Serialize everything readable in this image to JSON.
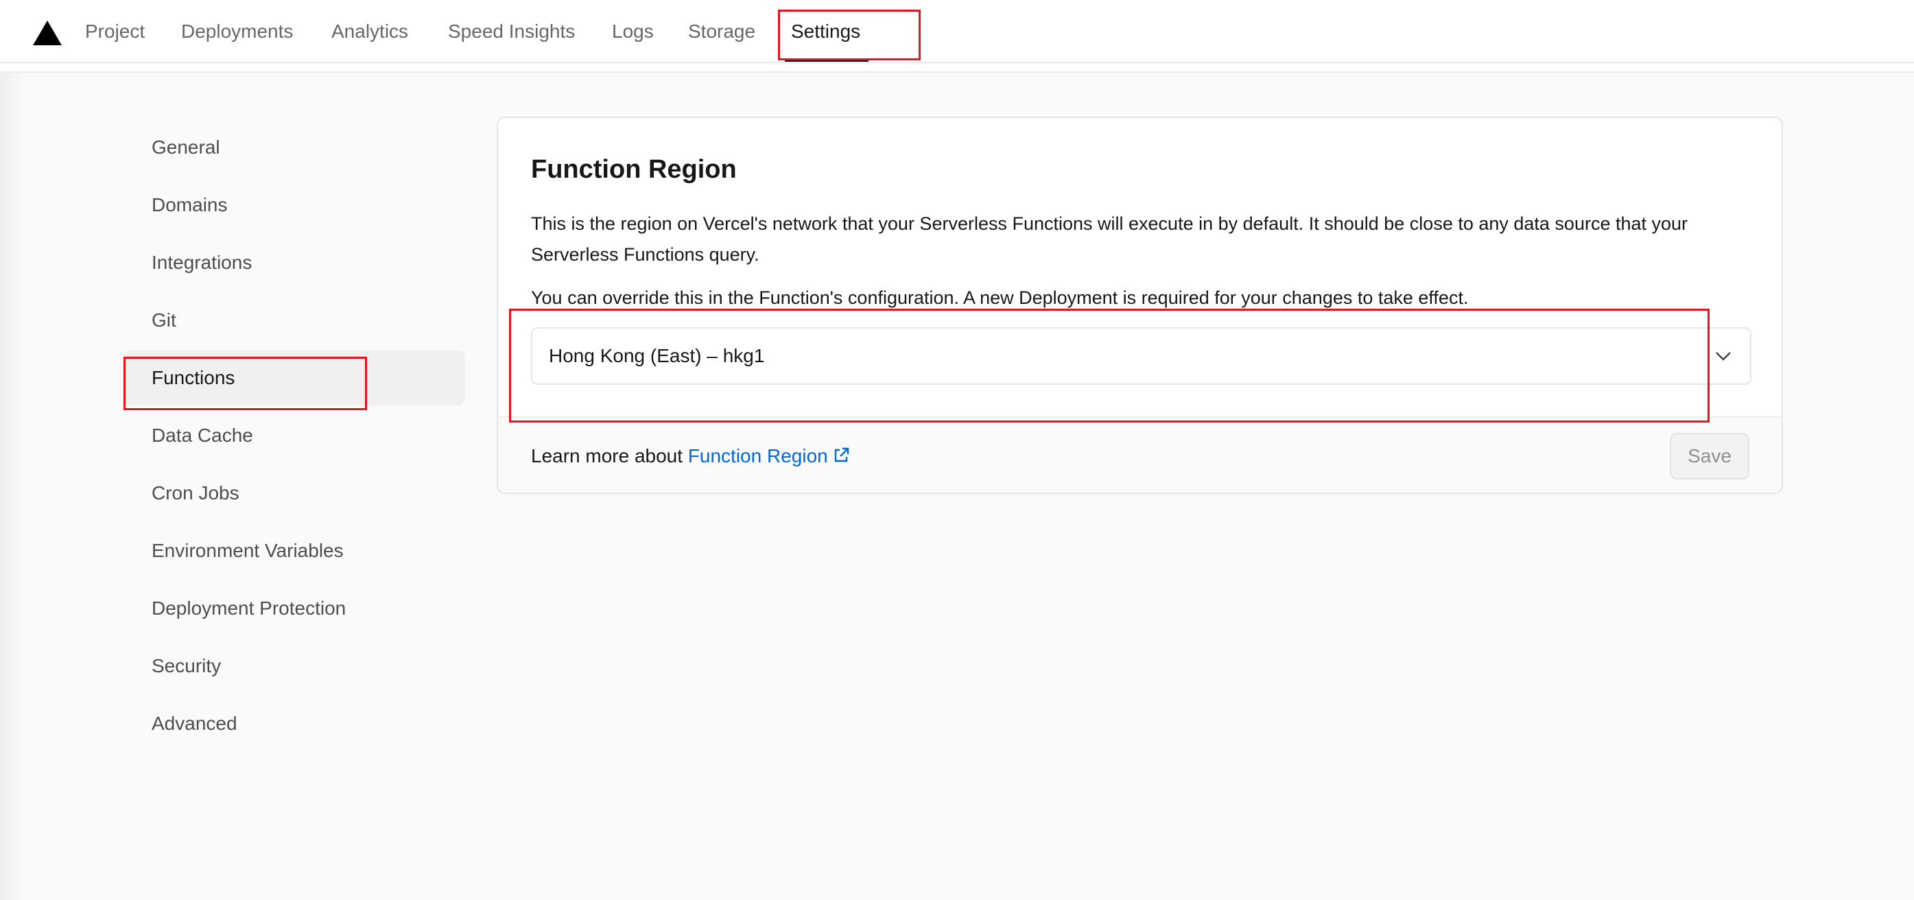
{
  "nav": {
    "tabs": [
      {
        "label": "Project"
      },
      {
        "label": "Deployments"
      },
      {
        "label": "Analytics"
      },
      {
        "label": "Speed Insights"
      },
      {
        "label": "Logs"
      },
      {
        "label": "Storage"
      },
      {
        "label": "Settings",
        "active": true
      }
    ]
  },
  "sidebar": {
    "items": [
      {
        "label": "General"
      },
      {
        "label": "Domains"
      },
      {
        "label": "Integrations"
      },
      {
        "label": "Git"
      },
      {
        "label": "Functions",
        "active": true
      },
      {
        "label": "Data Cache"
      },
      {
        "label": "Cron Jobs"
      },
      {
        "label": "Environment Variables"
      },
      {
        "label": "Deployment Protection"
      },
      {
        "label": "Security"
      },
      {
        "label": "Advanced"
      }
    ]
  },
  "function_region": {
    "title": "Function Region",
    "description": "This is the region on Vercel's network that your Serverless Functions will execute in by default. It should be close to any data source that your Serverless Functions query.",
    "note": "You can override this in the Function's configuration. A new Deployment is required for your changes to take effect.",
    "selected_region": "Hong Kong (East) – hkg1",
    "footer_text": "Learn more about ",
    "footer_link": "Function Region",
    "save_label": "Save"
  },
  "icons": {
    "logo": "vercel-triangle-icon",
    "select": "chevron-down-icon",
    "link": "external-link-icon"
  },
  "colors": {
    "link": "#0068d6",
    "highlight": "#e8121f",
    "text": "#171717",
    "muted": "#666666"
  }
}
